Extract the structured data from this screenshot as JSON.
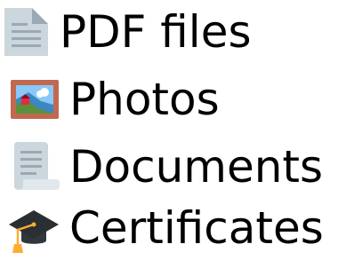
{
  "items": [
    {
      "icon": "document-page-icon",
      "label": "PDF files"
    },
    {
      "icon": "framed-picture-icon",
      "label": "Photos"
    },
    {
      "icon": "scroll-page-icon",
      "label": "Documents"
    },
    {
      "icon": "graduation-cap-icon",
      "label": "Certificates"
    }
  ]
}
